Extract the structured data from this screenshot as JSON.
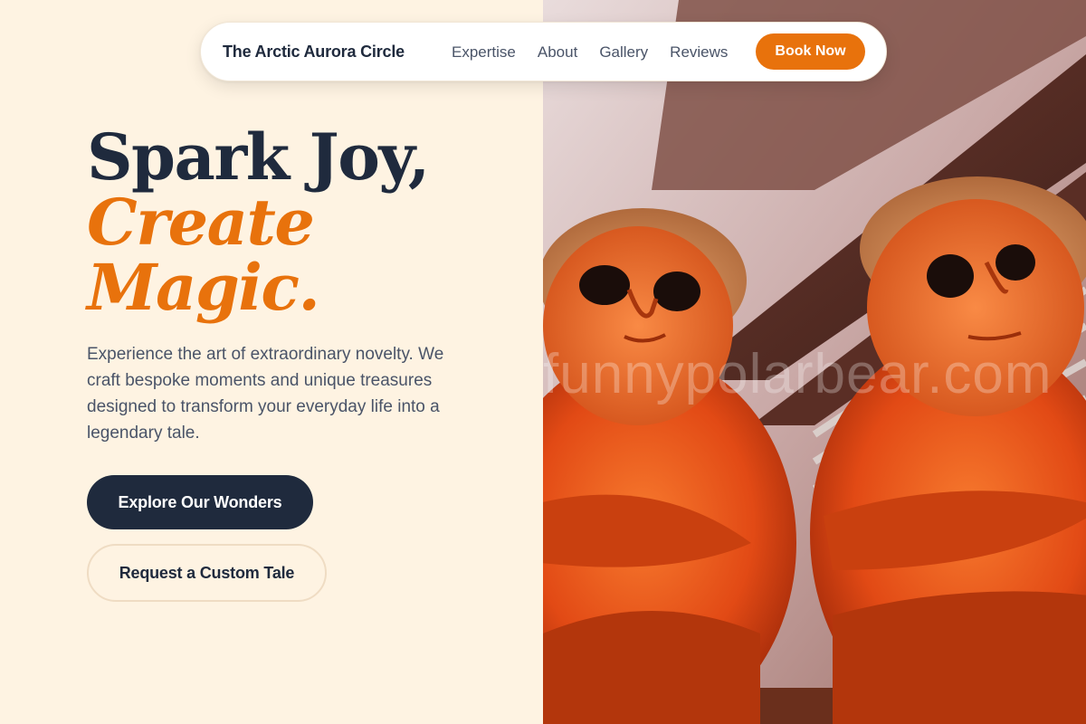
{
  "nav": {
    "brand": "The Arctic Aurora Circle",
    "links": [
      {
        "label": "Expertise"
      },
      {
        "label": "About"
      },
      {
        "label": "Gallery"
      },
      {
        "label": "Reviews"
      }
    ],
    "cta_label": "Book Now"
  },
  "hero": {
    "headline_line1": "Spark Joy,",
    "headline_line2": "Create",
    "headline_line3": "Magic.",
    "description": "Experience the art of extraordinary novelty. We craft bespoke moments and unique treasures designed to transform your everyday life into a legendary tale.",
    "primary_button": "Explore Our Wonders",
    "secondary_button": "Request a Custom Tale"
  },
  "image": {
    "subject": "coconut-husk-monkey-figurines-photo",
    "watermark": "funnypolarbear.com"
  },
  "colors": {
    "background": "#fef3e2",
    "navy": "#1f2a3d",
    "accent_orange": "#e8720c",
    "body_text": "#4a5468"
  }
}
